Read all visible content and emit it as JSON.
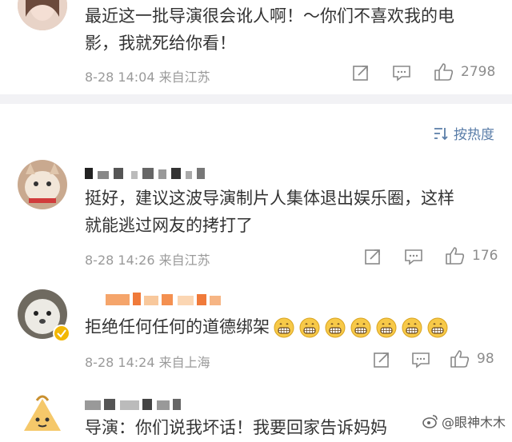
{
  "comments": [
    {
      "text_line1": "最近这一批导演很会讹人啊！～你们不喜欢我的电",
      "text_line2": "影，我就死给你看！",
      "meta": "8-28 14:04 来自江苏",
      "likes": "2798"
    },
    {
      "text_line1": "挺好，建议这波导演制片人集体退出娱乐圈，这样",
      "text_line2": "就能逃过网友的拷打了",
      "meta": "8-28 14:26 来自江苏",
      "likes": "176"
    },
    {
      "text_line1": "拒绝任何任何的道德绑架",
      "emoji_count": 7,
      "meta": "8-28 14:24 来自上海",
      "likes": "98"
    },
    {
      "text_line1": "导演：你们说我坏话！我要回家告诉妈妈"
    }
  ],
  "sort": {
    "label": "按热度"
  },
  "watermark": {
    "text": "@眼神木木"
  },
  "colors": {
    "accent": "#5a7da8",
    "meta": "#9a9a9a",
    "divider": "#f2f2f5"
  }
}
